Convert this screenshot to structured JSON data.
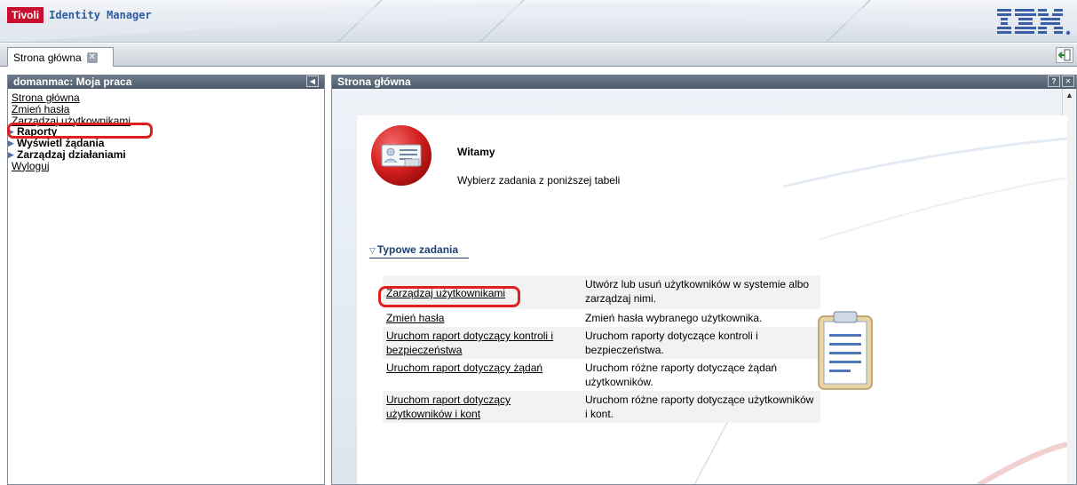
{
  "banner": {
    "brand": "Tivoli",
    "product": "Identity Manager",
    "vendor_logo": "IBM"
  },
  "tabs": [
    {
      "label": "Strona główna",
      "close_icon": "close-icon"
    }
  ],
  "left_panel": {
    "title": "domanmac: Moja praca",
    "items": [
      {
        "label": "Strona główna",
        "kind": "link"
      },
      {
        "label": "Zmień hasła",
        "kind": "link"
      },
      {
        "label": "Zarządzaj użytkownikami",
        "kind": "link"
      },
      {
        "label": "Raporty",
        "kind": "group"
      },
      {
        "label": "Wyświetl żądania",
        "kind": "group"
      },
      {
        "label": "Zarządzaj działaniami",
        "kind": "group"
      },
      {
        "label": "Wyloguj",
        "kind": "link"
      }
    ]
  },
  "right_panel": {
    "title": "Strona główna",
    "welcome_title": "Witamy",
    "welcome_text": "Wybierz zadania z poniższej tabeli",
    "section_title": "Typowe zadania",
    "tasks": [
      {
        "link": "Zarządzaj użytkownikami",
        "description": "Utwórz lub usuń użytkowników w systemie albo zarządzaj nimi."
      },
      {
        "link": "Zmień hasła",
        "description": "Zmień hasła wybranego użytkownika."
      },
      {
        "link": "Uruchom raport dotyczący kontroli i bezpieczeństwa",
        "description": "Uruchom raporty dotyczące kontroli i bezpieczeństwa."
      },
      {
        "link": "Uruchom raport dotyczący żądań",
        "description": "Uruchom różne raporty dotyczące żądań użytkowników."
      },
      {
        "link": "Uruchom raport dotyczący użytkowników i kont",
        "description": "Uruchom różne raporty dotyczące użytkowników i kont."
      }
    ]
  },
  "colors": {
    "brand_red": "#c8102e",
    "header_gray": "#5a6877",
    "link_blue": "#1f3e72",
    "highlight_red": "#e02020"
  }
}
